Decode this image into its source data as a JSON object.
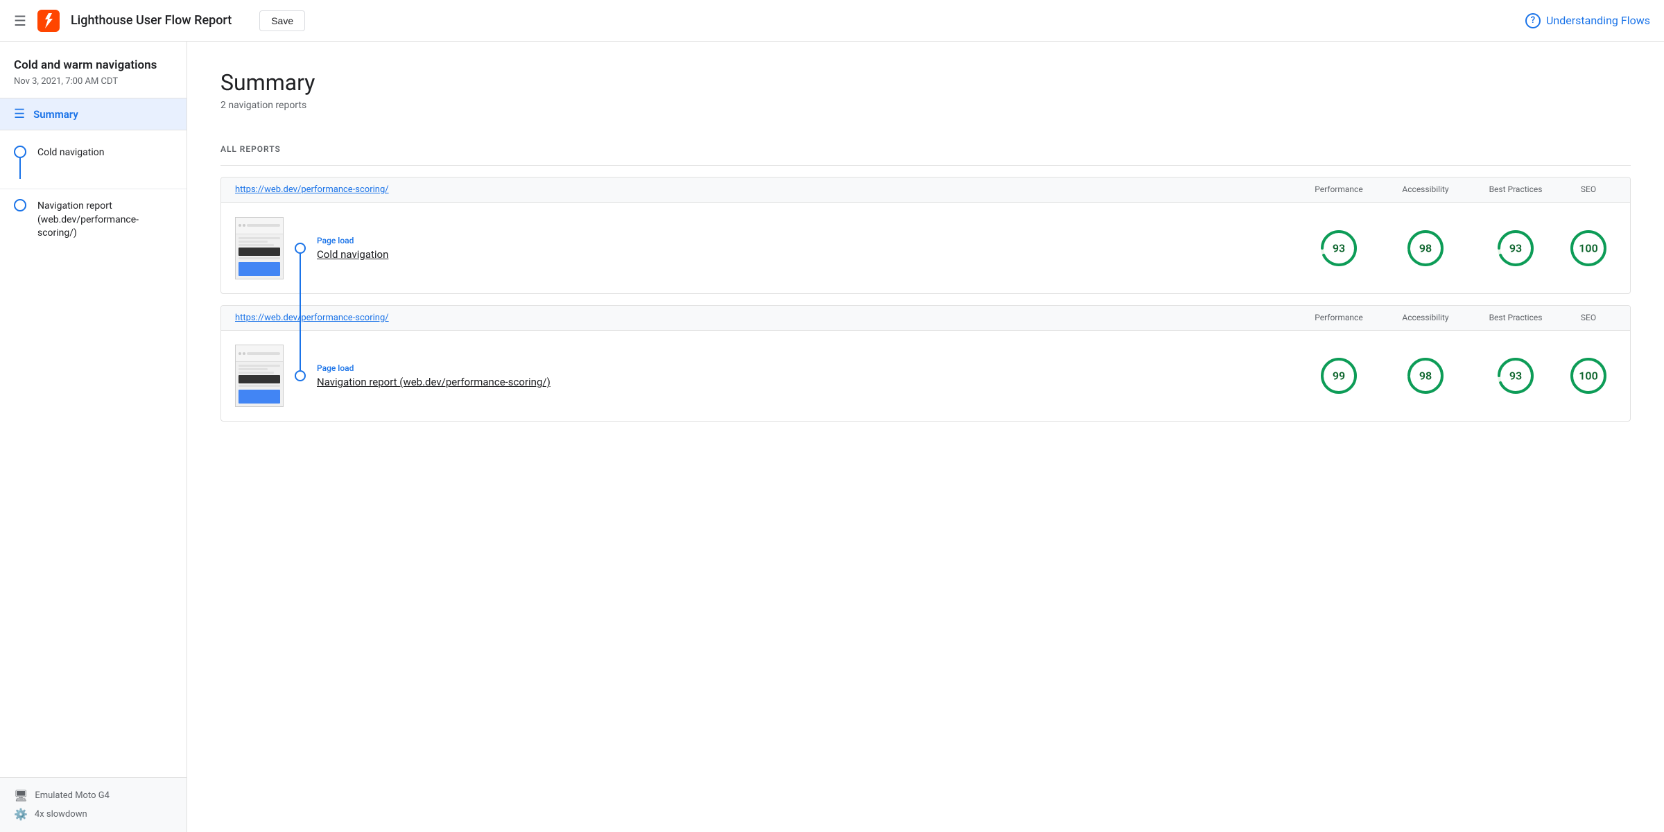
{
  "header": {
    "menu_icon": "☰",
    "title": "Lighthouse User Flow Report",
    "save_label": "Save",
    "understanding_flows": "Understanding Flows",
    "question_mark": "?"
  },
  "sidebar": {
    "project_title": "Cold and warm navigations",
    "date": "Nov 3, 2021, 7:00 AM CDT",
    "summary_label": "Summary",
    "nav_items": [
      {
        "label": "Cold navigation",
        "has_line": true
      },
      {
        "label": "Navigation report (web.dev/performance-scoring/)",
        "has_line": false
      }
    ],
    "device_info": [
      {
        "icon": "🖥",
        "label": "Emulated Moto G4"
      },
      {
        "icon": "⚙",
        "label": "4x slowdown"
      }
    ]
  },
  "summary": {
    "title": "Summary",
    "subtitle": "2 navigation reports",
    "all_reports_label": "ALL REPORTS"
  },
  "reports": [
    {
      "url": "https://web.dev/performance-scoring/",
      "columns": [
        "Performance",
        "Accessibility",
        "Best Practices",
        "SEO"
      ],
      "type_label": "Page load",
      "name": "Cold navigation",
      "scores": [
        93,
        98,
        93,
        100
      ],
      "has_connector_below": true
    },
    {
      "url": "https://web.dev/performance-scoring/",
      "columns": [
        "Performance",
        "Accessibility",
        "Best Practices",
        "SEO"
      ],
      "type_label": "Page load",
      "name": "Navigation report (web.dev/performance-scoring/)",
      "scores": [
        99,
        98,
        93,
        100
      ],
      "has_connector_below": false
    }
  ]
}
